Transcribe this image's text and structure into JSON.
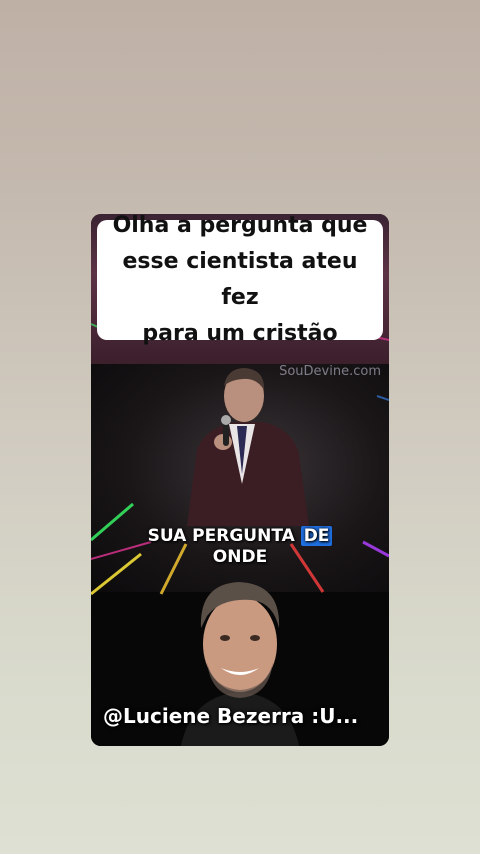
{
  "post": {
    "caption": "Olha a pergunta que\nesse cientista ateu fez\npara um cristão",
    "video_watermark": "SouDevine.com",
    "subtitle": {
      "before": "SUA PERGUNTA ",
      "highlight": "DE",
      "after": "ONDE"
    },
    "username": "@Luciene Bezerra :U..."
  },
  "colors": {
    "background_top": "#bfb0a6",
    "background_bottom": "#dde0d2",
    "subtitle_highlight": "#1f6fe0"
  },
  "icons": {
    "light_rays": "neon-light-rays-decoration"
  }
}
